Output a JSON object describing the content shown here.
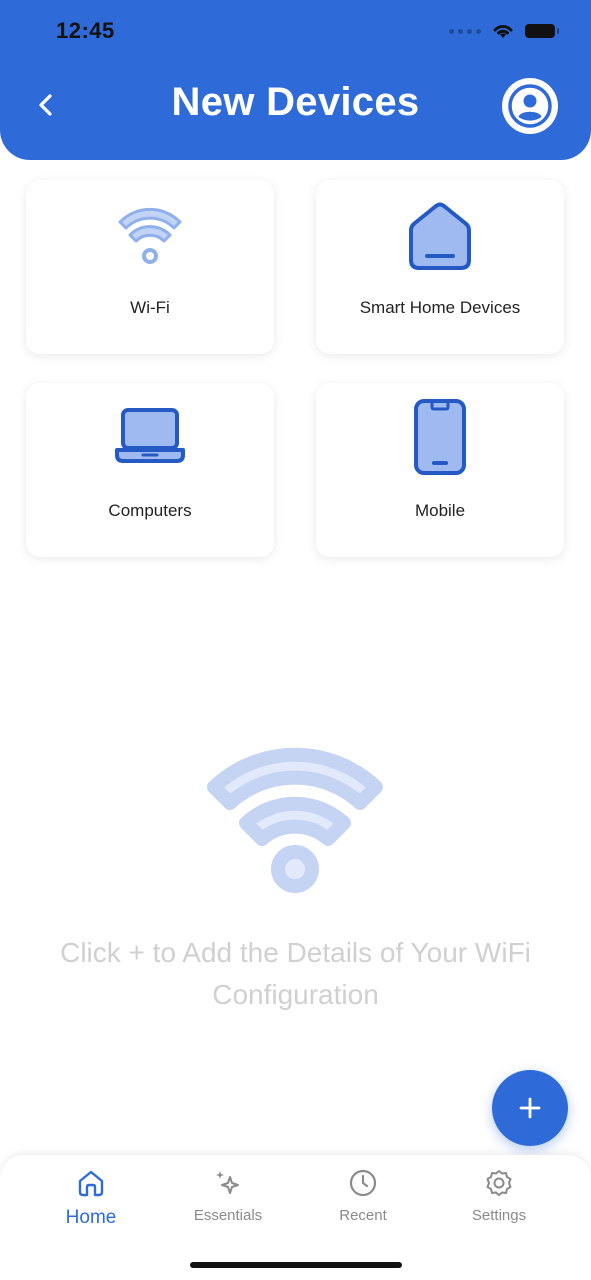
{
  "status_bar": {
    "time": "12:45"
  },
  "header": {
    "title": "New Devices"
  },
  "categories": [
    {
      "label": "Wi-Fi",
      "icon": "wifi-icon"
    },
    {
      "label": "Smart Home Devices",
      "icon": "home-icon"
    },
    {
      "label": "Computers",
      "icon": "laptop-icon"
    },
    {
      "label": "Mobile",
      "icon": "phone-icon"
    }
  ],
  "empty_state": {
    "icon": "wifi-large-icon",
    "message": "Click + to Add the Details of Your WiFi Configuration"
  },
  "fab": {
    "icon": "plus-icon"
  },
  "tabbar": {
    "items": [
      {
        "label": "Home",
        "icon": "home-outline-icon",
        "active": true
      },
      {
        "label": "Essentials",
        "icon": "sparkle-icon",
        "active": false
      },
      {
        "label": "Recent",
        "icon": "clock-icon",
        "active": false
      },
      {
        "label": "Settings",
        "icon": "gear-icon",
        "active": false
      }
    ]
  },
  "colors": {
    "primary": "#2f6bd8",
    "icon_fill": "#9fbaf0",
    "empty_text": "#d0d0d0",
    "inactive_tab": "#8a8a8a"
  }
}
